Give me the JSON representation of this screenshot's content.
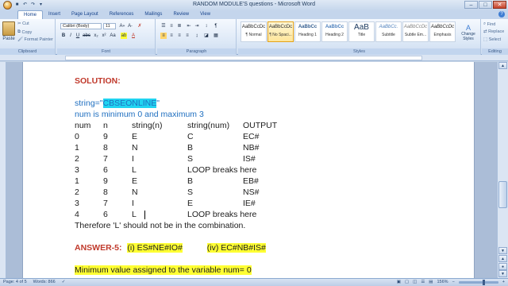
{
  "window": {
    "title": "RANDOM MODULE'S questions - Microsoft Word"
  },
  "tabs": [
    "Home",
    "Insert",
    "Page Layout",
    "References",
    "Mailings",
    "Review",
    "View"
  ],
  "ribbon": {
    "clipboard": {
      "paste": "Paste",
      "cut": "Cut",
      "copy": "Copy",
      "format_painter": "Format Painter",
      "label": "Clipboard"
    },
    "font": {
      "name": "Calibri (Body)",
      "size": "11",
      "label": "Font"
    },
    "paragraph": {
      "label": "Paragraph"
    },
    "styles": {
      "label": "Styles",
      "items": [
        {
          "sample": "AaBbCcDc",
          "name": "¶ Normal"
        },
        {
          "sample": "AaBbCcDc",
          "name": "¶ No Spaci..."
        },
        {
          "sample": "AaBbCc",
          "name": "Heading 1"
        },
        {
          "sample": "AaBbCc",
          "name": "Heading 2"
        },
        {
          "sample": "AaB",
          "name": "Title"
        },
        {
          "sample": "AaBbCc.",
          "name": "Subtitle"
        },
        {
          "sample": "AaBbCcDc",
          "name": "Subtle Em..."
        },
        {
          "sample": "AaBbCcDc",
          "name": "Emphasis"
        }
      ],
      "change_styles": "Change Styles"
    },
    "editing": {
      "find": "Find",
      "replace": "Replace",
      "select": "Select",
      "label": "Editing"
    }
  },
  "doc": {
    "solution": "SOLUTION:",
    "string_prefix": "string=\"",
    "string_val": "CBSEONLINE",
    "string_suffix": "\"",
    "range_line": "num is minimum 0 and maximum 3",
    "headers": [
      "num",
      "n",
      "string(n)",
      "string(num)",
      "OUTPUT"
    ],
    "rows": [
      [
        "0",
        "9",
        "E",
        "C",
        "EC#"
      ],
      [
        "1",
        "8",
        "N",
        "B",
        "NB#"
      ],
      [
        "2",
        "7",
        "I",
        "S",
        "IS#"
      ],
      [
        "3",
        "6",
        "L",
        "LOOP breaks here",
        ""
      ],
      [
        "1",
        "9",
        "E",
        "B",
        "EB#"
      ],
      [
        "2",
        "8",
        "N",
        "S",
        "NS#"
      ],
      [
        "3",
        "7",
        "I",
        "E",
        "IE#"
      ],
      [
        "4",
        "6",
        "L",
        "LOOP breaks here",
        ""
      ]
    ],
    "therefore": "Therefore 'L' should not be in the combination.",
    "answer_label": "ANSWER-5:",
    "answer_i": "(i) ES#NE#IO#",
    "answer_iv": "(iv) EC#NB#IS#",
    "min_line": "Minimum value assigned to the variable num= 0"
  },
  "status": {
    "page": "Page: 4 of 5",
    "words": "Words: 866",
    "zoom": "156%"
  }
}
